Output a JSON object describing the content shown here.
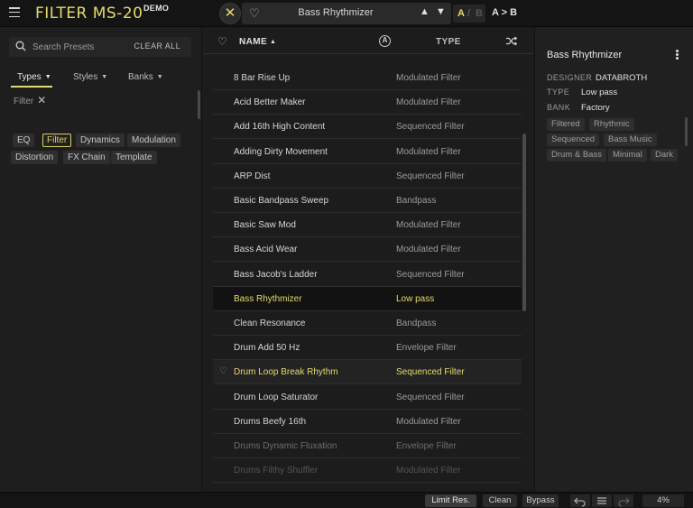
{
  "app": {
    "title": "FILTER MS-20",
    "badge": "DEMO"
  },
  "topbar": {
    "menu_icon": "hamburger-icon",
    "close_icon": "close-icon",
    "heart_icon": "heart-icon",
    "preset_name": "Bass Rhythmizer",
    "prev_symbol": "▲",
    "next_symbol": "▼",
    "ab_a": "A",
    "ab_slash": "/",
    "ab_b": "B",
    "a_to_b": "A > B"
  },
  "left": {
    "search_placeholder": "Search Presets",
    "clear_all": "CLEAR ALL",
    "tabs": [
      "Types",
      "Styles",
      "Banks"
    ],
    "active_filter": "Filter",
    "tags_row1": [
      "EQ",
      "Filter",
      "Dynamics",
      "Modulation"
    ],
    "tags_row2": [
      "Distortion",
      "FX Chain",
      "Template"
    ],
    "selected_tag": "Filter"
  },
  "list": {
    "col_name": "NAME",
    "col_type": "TYPE",
    "rows": [
      {
        "name": "8 Bar Rise Up",
        "type": "Modulated Filter"
      },
      {
        "name": "Acid Better Maker",
        "type": "Modulated Filter"
      },
      {
        "name": "Add 16th High Content",
        "type": "Sequenced Filter"
      },
      {
        "name": "Adding Dirty Movement",
        "type": "Modulated Filter"
      },
      {
        "name": "ARP Dist",
        "type": "Sequenced Filter"
      },
      {
        "name": "Basic Bandpass Sweep",
        "type": "Bandpass"
      },
      {
        "name": "Basic Saw Mod",
        "type": "Modulated Filter"
      },
      {
        "name": "Bass Acid Wear",
        "type": "Modulated Filter"
      },
      {
        "name": "Bass Jacob's Ladder",
        "type": "Sequenced Filter"
      },
      {
        "name": "Bass Rhythmizer",
        "type": "Low pass"
      },
      {
        "name": "Clean Resonance",
        "type": "Bandpass"
      },
      {
        "name": "Drum Add 50 Hz",
        "type": "Envelope Filter"
      },
      {
        "name": "Drum Loop Break Rhythm",
        "type": "Sequenced Filter"
      },
      {
        "name": "Drum Loop Saturator",
        "type": "Sequenced Filter"
      },
      {
        "name": "Drums Beefy 16th",
        "type": "Modulated Filter"
      },
      {
        "name": "Drums Dynamic Fluxation",
        "type": "Envelope Filter"
      },
      {
        "name": "Drums Filthy Shuffler",
        "type": "Modulated Filter"
      }
    ]
  },
  "details": {
    "title": "Bass Rhythmizer",
    "designer_label": "DESIGNER",
    "designer": "DATABROTH",
    "type_label": "TYPE",
    "type": "Low pass",
    "bank_label": "BANK",
    "bank": "Factory",
    "tags": [
      "Filtered",
      "Rhythmic",
      "Sequenced",
      "Bass Music",
      "Drum & Bass",
      "Minimal",
      "Dark"
    ]
  },
  "status": {
    "limit_res": "Limit Res.",
    "clean": "Clean",
    "bypass": "Bypass",
    "cpu": "4%"
  },
  "colors": {
    "accent": "#e6db6a"
  }
}
